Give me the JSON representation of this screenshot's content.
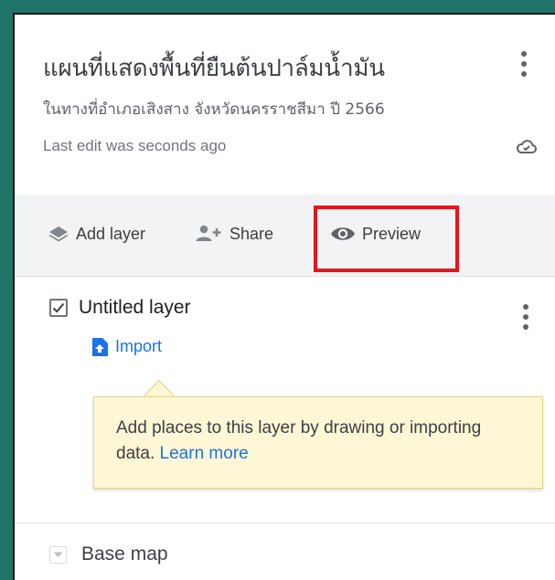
{
  "header": {
    "title": "แผนที่แสดงพื้นที่ยืนต้นปาล์มน้ำมัน",
    "subtitle": "ในทางที่อำเภอเสิงสาง จังหวัดนครราชสีมา ปี 2566",
    "last_edit": "Last edit was seconds ago",
    "more_icon": "more-vert-icon",
    "save_icon": "cloud-check-icon"
  },
  "toolbar": {
    "add_layer_label": "Add layer",
    "add_layer_icon": "layers-icon",
    "share_label": "Share",
    "share_icon": "person-add-icon",
    "preview_label": "Preview",
    "preview_icon": "eye-icon",
    "highlight_color": "#e8141b"
  },
  "layer": {
    "name": "Untitled layer",
    "checked": true,
    "import_label": "Import",
    "import_icon": "file-upload-icon",
    "tooltip_text": "Add places to this layer by drawing or importing data.",
    "tooltip_link": "Learn more"
  },
  "basemap": {
    "label": "Base map",
    "icon": "chevron-down-icon"
  },
  "colors": {
    "frame": "#1e7567",
    "accent": "#1a73e8",
    "toolbar_bg": "#f1f3f4",
    "tooltip_bg": "#fef7d6"
  }
}
